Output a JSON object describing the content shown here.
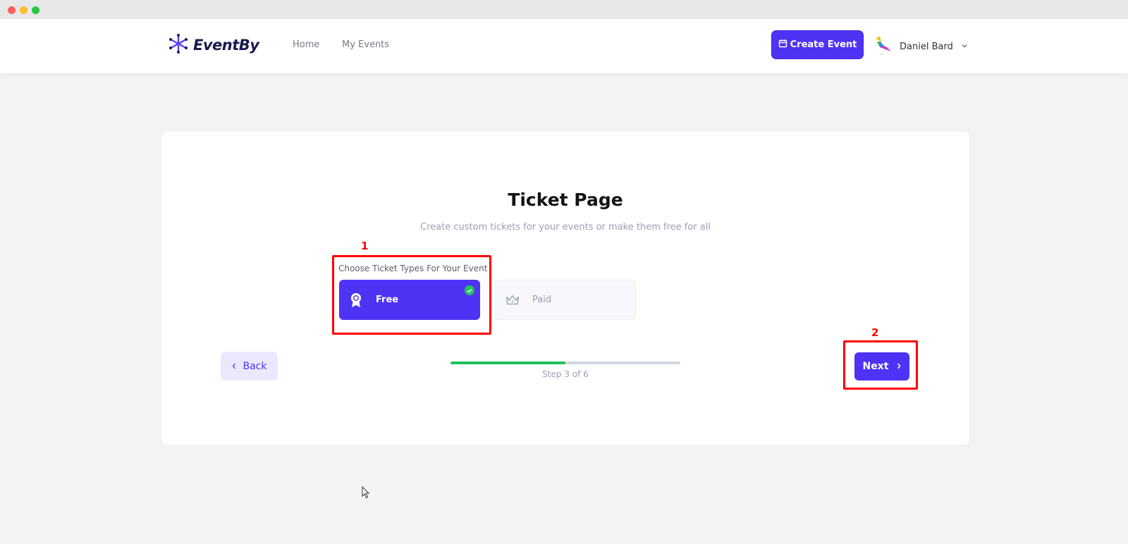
{
  "window": {
    "controls": [
      "close",
      "minimize",
      "maximize"
    ]
  },
  "navbar": {
    "logo_text": "EventBy",
    "logo_icon": "snowflake-icon",
    "links": [
      {
        "label": "Home"
      },
      {
        "label": "My Events"
      }
    ],
    "create_button": {
      "label": "Create Event",
      "icon": "calendar-icon"
    },
    "user": {
      "name": "Daniel Bard",
      "avatar": "bird-avatar",
      "dropdown_icon": "chevron-down-icon"
    }
  },
  "page": {
    "title": "Ticket Page",
    "subtitle": "Create custom tickets for your events or make them free for all",
    "ticket_types": {
      "label": "Choose Ticket Types For Your Event",
      "options": [
        {
          "label": "Free",
          "icon": "award-ribbon-icon",
          "selected": true
        },
        {
          "label": "Paid",
          "icon": "crown-icon",
          "selected": false
        }
      ]
    },
    "back_button": {
      "label": "Back",
      "icon": "chevron-left-icon"
    },
    "next_button": {
      "label": "Next",
      "icon": "chevron-right-icon"
    },
    "progress": {
      "current_step": 3,
      "total_steps": 6,
      "text": "Step 3 of 6",
      "fraction": 0.5
    }
  },
  "annotations": [
    {
      "number": "1",
      "target": "ticket-type-selector"
    },
    {
      "number": "2",
      "target": "next-button"
    }
  ],
  "colors": {
    "accent": "#4f33f5",
    "success": "#20c35a",
    "annotation": "#ff0000"
  }
}
